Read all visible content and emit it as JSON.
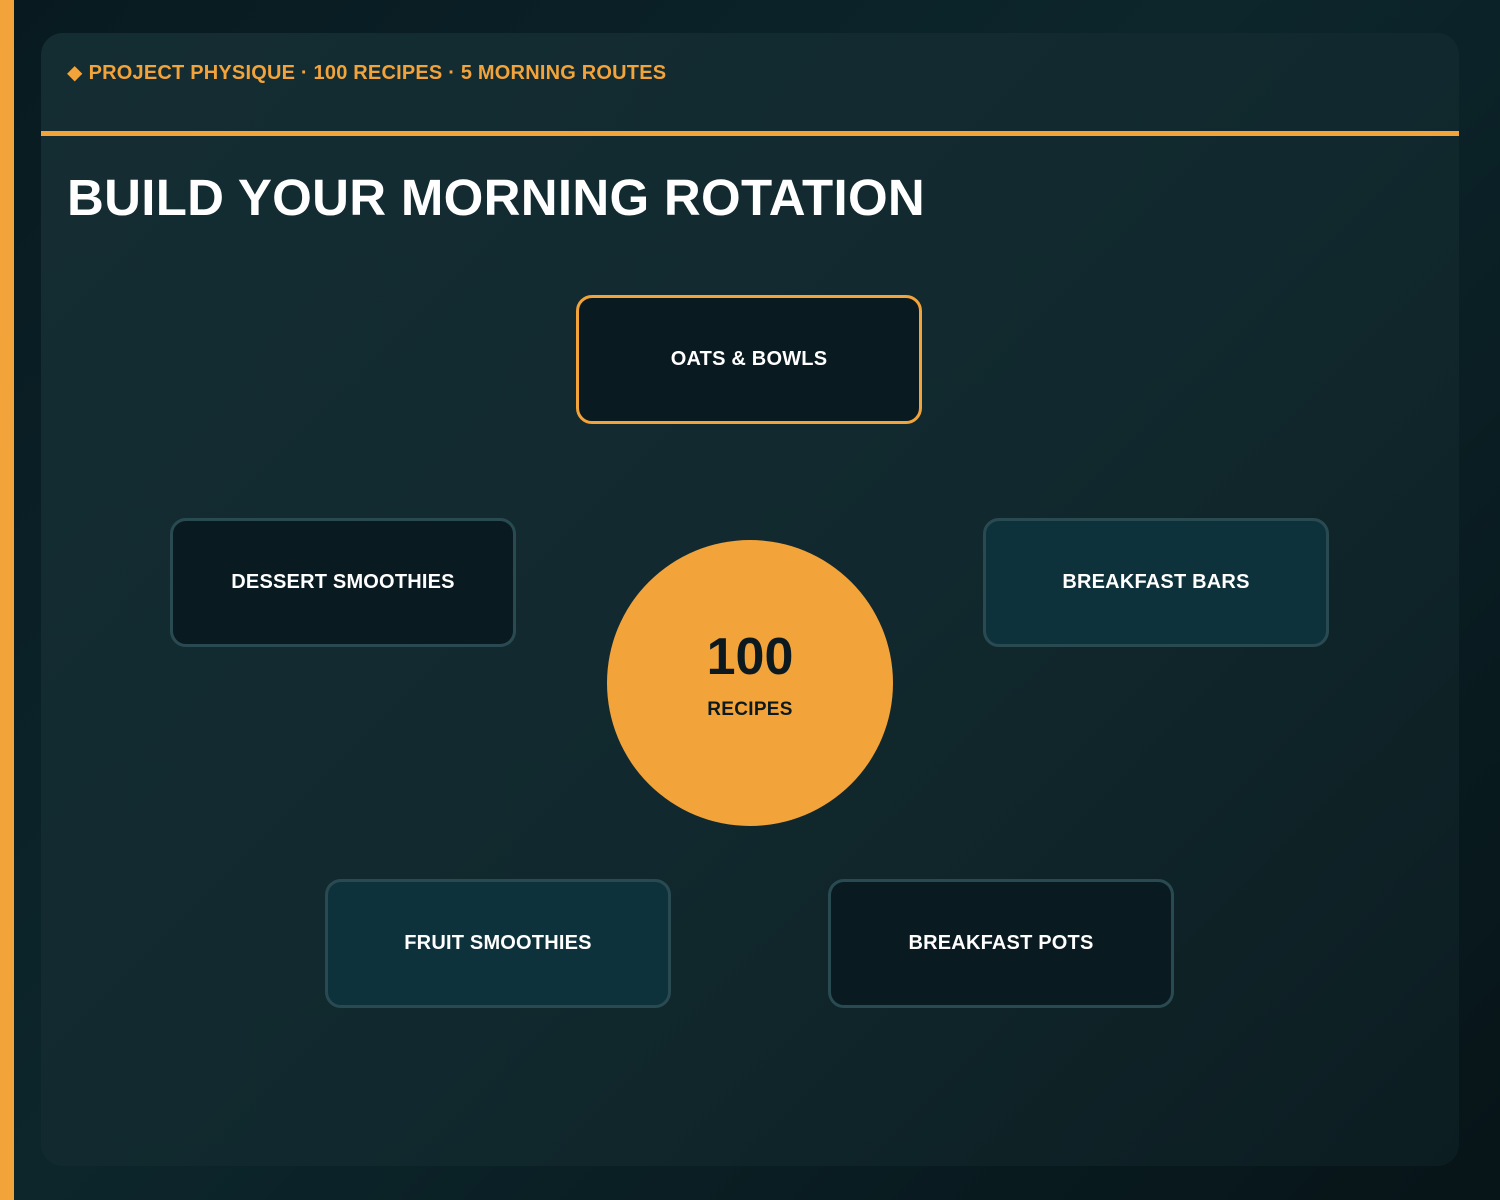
{
  "header": {
    "eyebrow_icon": "diamond-icon",
    "eyebrow_glyph": "◆",
    "eyebrow": "PROJECT PHYSIQUE · 100 RECIPES · 5 MORNING ROUTES",
    "title": "BUILD YOUR MORNING ROTATION"
  },
  "hub": {
    "number": "100",
    "label": "RECIPES"
  },
  "nodes": [
    {
      "label": "OATS & BOWLS",
      "style": "dark",
      "highlighted": true
    },
    {
      "label": "DESSERT SMOOTHIES",
      "style": "dark",
      "highlighted": false
    },
    {
      "label": "BREAKFAST BARS",
      "style": "teal",
      "highlighted": false
    },
    {
      "label": "FRUIT SMOOTHIES",
      "style": "teal",
      "highlighted": false
    },
    {
      "label": "BREAKFAST POTS",
      "style": "dark",
      "highlighted": false
    }
  ],
  "colors": {
    "accent": "#f2a33a",
    "background": "#0b2328",
    "node_dark": "#0a1a21",
    "node_teal": "#0e323b",
    "node_border": "#2a4a52",
    "text_primary": "#ffffff",
    "hub_text": "#0c1a1f"
  }
}
